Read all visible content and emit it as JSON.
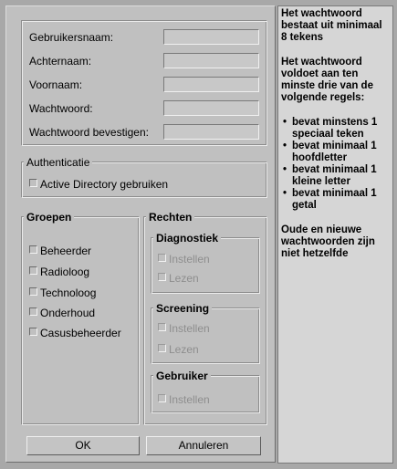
{
  "form": {
    "fields": [
      {
        "label": "Gebruikersnaam:",
        "value": ""
      },
      {
        "label": "Achternaam:",
        "value": ""
      },
      {
        "label": "Voornaam:",
        "value": ""
      },
      {
        "label": "Wachtwoord:",
        "value": ""
      },
      {
        "label": "Wachtwoord bevestigen:",
        "value": ""
      }
    ]
  },
  "auth": {
    "legend": "Authenticatie",
    "ad_label": "Active Directory gebruiken"
  },
  "groups": {
    "legend": "Groepen",
    "items": [
      "Beheerder",
      "Radioloog",
      "Technoloog",
      "Onderhoud",
      "Casusbeheerder"
    ]
  },
  "rights": {
    "legend": "Rechten",
    "diagnostics": {
      "legend": "Diagnostiek",
      "items": [
        "Instellen",
        "Lezen"
      ]
    },
    "screening": {
      "legend": "Screening",
      "items": [
        "Instellen",
        "Lezen"
      ]
    },
    "user": {
      "legend": "Gebruiker",
      "items": [
        "Instellen"
      ]
    }
  },
  "buttons": {
    "ok": "OK",
    "cancel": "Annuleren"
  },
  "help": {
    "intro": "Het wachtwoord bestaat uit minimaal 8 tekens",
    "rules_intro": "Het wachtwoord voldoet aan ten minste drie van de volgende regels:",
    "rules": [
      "bevat minstens 1 speciaal teken",
      "bevat minimaal 1 hoofdletter",
      "bevat minimaal 1 kleine letter",
      "bevat minimaal 1 getal"
    ],
    "outro": "Oude en nieuwe wachtwoorden zijn niet hetzelfde"
  }
}
